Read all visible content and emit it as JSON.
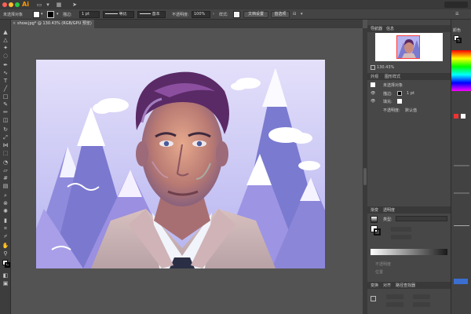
{
  "titlebar": {
    "app_logo": "Ai",
    "icons": [
      "library-icon",
      "chevron-down-icon",
      "arrange-documents-icon",
      "send-icon"
    ]
  },
  "controlbar": {
    "selection_label": "未选择对象",
    "stroke_label": "描边:",
    "stroke_value": "1 pt",
    "stroke_profile": "等比",
    "brush_label": "基本",
    "opacity_label": "不透明度:",
    "opacity_value": "100%",
    "style_label": "样式:",
    "document_setup_button": "文档设置",
    "preferences_button": "首选项"
  },
  "document": {
    "tab_title": "show.jpg* @ 130.43% (RGB/GPU 预览)",
    "close_glyph": "×"
  },
  "panels": {
    "navigator_tabs": [
      "导航器",
      "信息"
    ],
    "navigator_zoom": "130.43%",
    "appearance_tabs": [
      "外观",
      "图形样式"
    ],
    "appearance_header": "未选择对象",
    "appearance_rows": [
      {
        "label": "描边:",
        "value": "1 pt"
      },
      {
        "label": "填充:",
        "value": ""
      },
      {
        "label": "不透明度:",
        "value": "默认值"
      }
    ],
    "gradient_tabs": [
      "渐变",
      "透明度"
    ],
    "gradient_type": "类型:",
    "gradient_options": [
      "不透明度",
      "位置"
    ],
    "bottom_tabs": [
      "变换",
      "对齐",
      "路径查找器"
    ],
    "color_tab": "颜色"
  },
  "colors": {
    "accent": "#ff9a00",
    "traffic_red": "#ff5f57",
    "traffic_yellow": "#febc2e",
    "traffic_green": "#28c840"
  }
}
